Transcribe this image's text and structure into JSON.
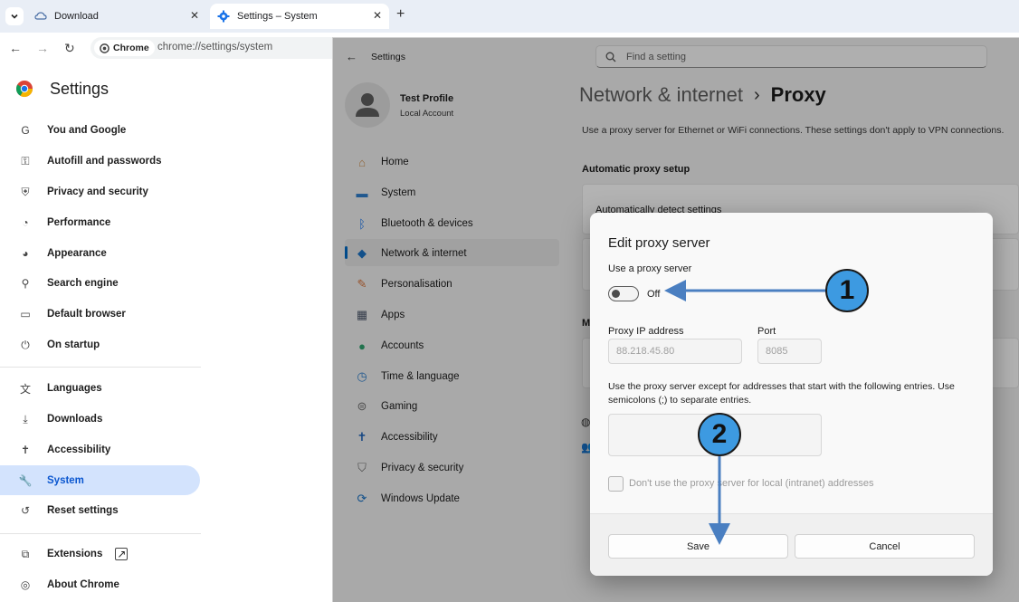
{
  "browser": {
    "tabs": [
      {
        "label": "Download"
      },
      {
        "label": "Settings – System"
      }
    ],
    "address": {
      "site_chip": "Chrome",
      "url": "chrome://settings/system"
    }
  },
  "chrome_settings": {
    "title": "Settings",
    "items": [
      {
        "label": "You and Google",
        "icon": "google-g-icon"
      },
      {
        "label": "Autofill and passwords",
        "icon": "key-icon"
      },
      {
        "label": "Privacy and security",
        "icon": "shield-icon"
      },
      {
        "label": "Performance",
        "icon": "speedometer-icon"
      },
      {
        "label": "Appearance",
        "icon": "palette-icon"
      },
      {
        "label": "Search engine",
        "icon": "search-icon"
      },
      {
        "label": "Default browser",
        "icon": "browser-window-icon"
      },
      {
        "label": "On startup",
        "icon": "power-icon"
      },
      {
        "label": "Languages",
        "icon": "translate-icon"
      },
      {
        "label": "Downloads",
        "icon": "download-icon"
      },
      {
        "label": "Accessibility",
        "icon": "accessibility-icon"
      },
      {
        "label": "System",
        "icon": "wrench-icon"
      },
      {
        "label": "Reset settings",
        "icon": "reset-icon"
      },
      {
        "label": "Extensions",
        "icon": "puzzle-icon"
      },
      {
        "label": "About Chrome",
        "icon": "chrome-icon"
      }
    ],
    "selected_index": 11
  },
  "windows_settings": {
    "back_title": "Settings",
    "search_placeholder": "Find a setting",
    "profile": {
      "name": "Test Profile",
      "account": "Local Account"
    },
    "nav": [
      {
        "label": "Home"
      },
      {
        "label": "System"
      },
      {
        "label": "Bluetooth & devices"
      },
      {
        "label": "Network & internet"
      },
      {
        "label": "Personalisation"
      },
      {
        "label": "Apps"
      },
      {
        "label": "Accounts"
      },
      {
        "label": "Time & language"
      },
      {
        "label": "Gaming"
      },
      {
        "label": "Accessibility"
      },
      {
        "label": "Privacy & security"
      },
      {
        "label": "Windows Update"
      }
    ],
    "selected_nav_index": 3,
    "breadcrumb": {
      "parent": "Network & internet",
      "separator": "›",
      "current": "Proxy"
    },
    "description": "Use a proxy server for Ethernet or WiFi connections. These settings don't apply to VPN connections.",
    "section_automatic": "Automatic proxy setup",
    "auto_detect_label": "Automatically detect settings",
    "section_manual_initial": "M"
  },
  "dialog": {
    "title": "Edit proxy server",
    "use_proxy_label": "Use a proxy server",
    "toggle_state": "Off",
    "ip_label": "Proxy IP address",
    "ip_value": "88.218.45.80",
    "port_label": "Port",
    "port_value": "8085",
    "exceptions_text": "Use the proxy server except for addresses that start with the following entries. Use semicolons (;) to separate entries.",
    "exceptions_value": "",
    "local_checkbox_label": "Don't use the proxy server for local (intranet) addresses",
    "save_label": "Save",
    "cancel_label": "Cancel"
  },
  "annotations": [
    {
      "number": "1"
    },
    {
      "number": "2"
    }
  ],
  "colors": {
    "annotation_blue": "#3d9ae1",
    "arrow_blue": "#4a7fc1",
    "chrome_selected": "#d3e3fd",
    "win_accent": "#0067c0"
  }
}
